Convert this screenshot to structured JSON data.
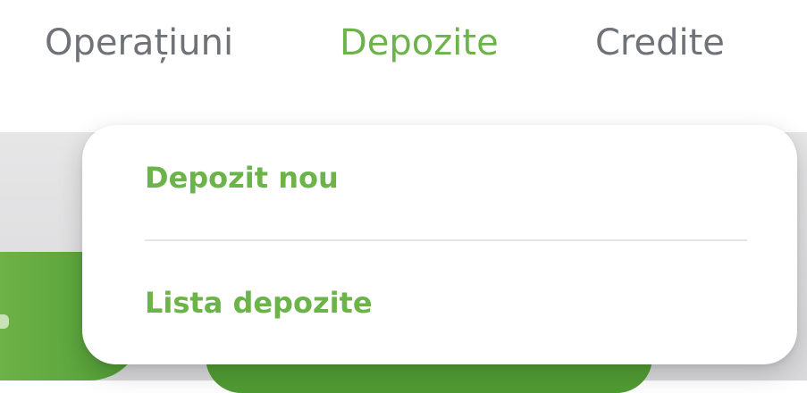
{
  "nav": {
    "items": [
      {
        "label": "Operațiuni"
      },
      {
        "label": "Depozite",
        "active": true
      },
      {
        "label": "Credite"
      }
    ]
  },
  "dropdown": {
    "items": [
      {
        "label": "Depozit nou"
      },
      {
        "label": "Lista depozite"
      }
    ]
  },
  "colors": {
    "accent": "#6cb34a",
    "nav_text": "#6f7277",
    "background": "#ffffff",
    "overlay": "#e0e0e2"
  }
}
